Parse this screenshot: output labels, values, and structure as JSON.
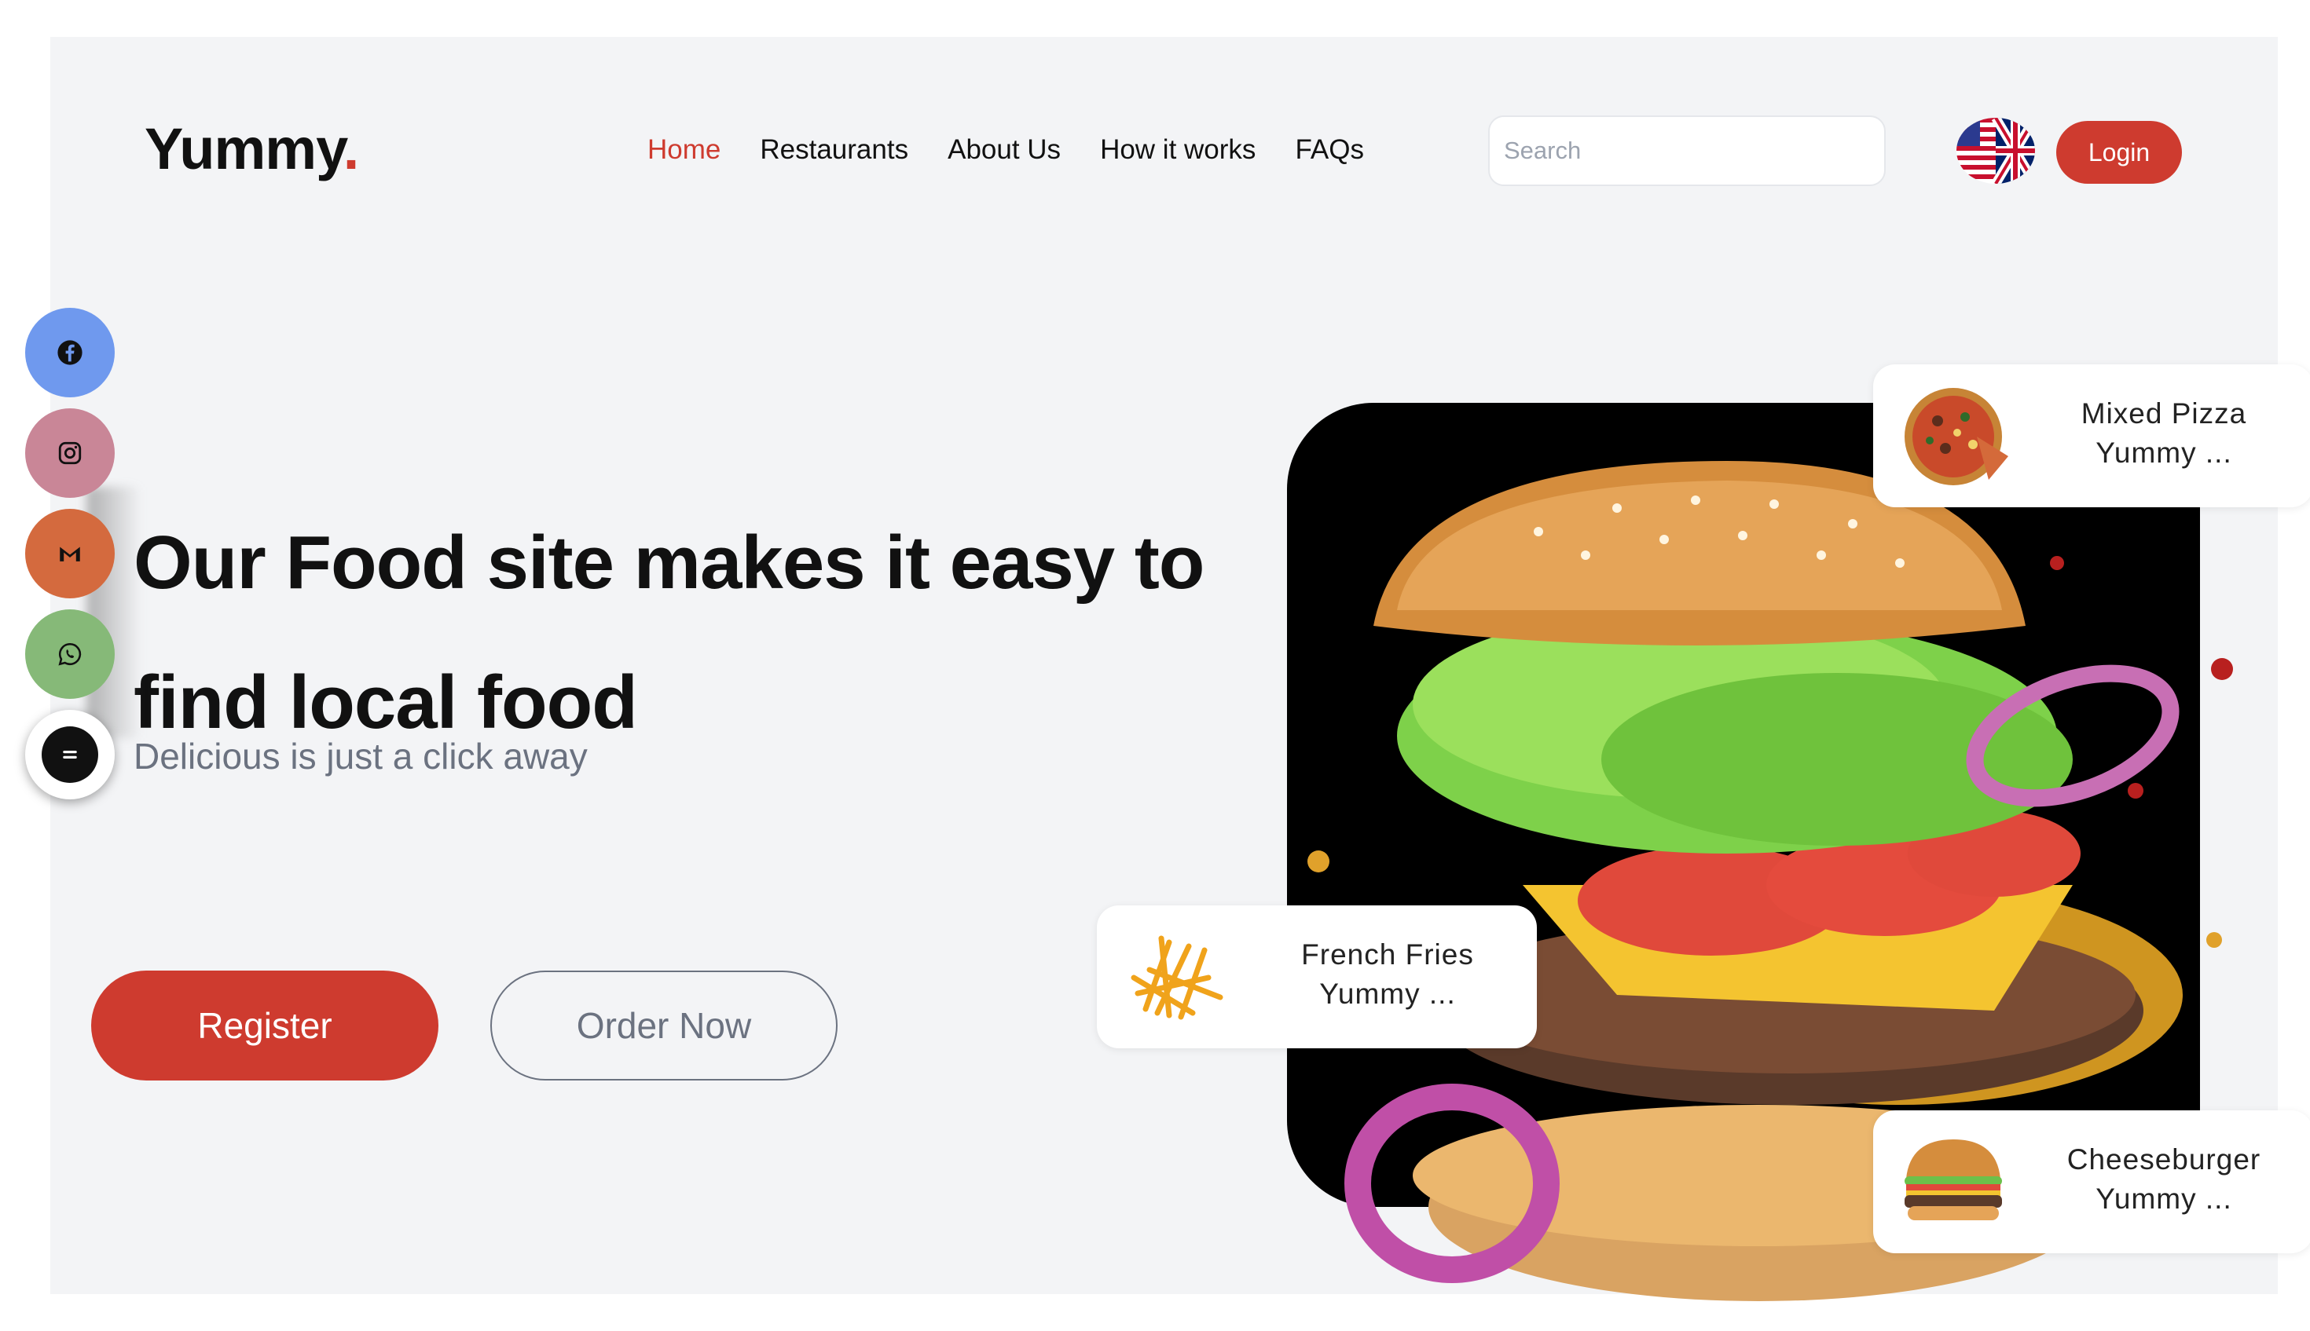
{
  "header": {
    "logo": "Yummy",
    "logo_dot": ".",
    "nav": [
      {
        "label": "Home",
        "active": true
      },
      {
        "label": "Restaurants",
        "active": false
      },
      {
        "label": "About Us",
        "active": false
      },
      {
        "label": "How it works",
        "active": false
      },
      {
        "label": "FAQs",
        "active": false
      }
    ],
    "search_placeholder": "Search",
    "language_icon": "us-uk-flag-icon",
    "login_label": "Login"
  },
  "social": [
    {
      "icon": "facebook-icon"
    },
    {
      "icon": "instagram-icon"
    },
    {
      "icon": "gmail-icon"
    },
    {
      "icon": "whatsapp-icon"
    },
    {
      "icon": "chat-icon"
    }
  ],
  "hero": {
    "title_line1": "Our Food site makes it easy to",
    "title_line2": "find local food",
    "subtitle": "Delicious is just a click away",
    "register_label": "Register",
    "order_label": "Order Now"
  },
  "cards": [
    {
      "name": "Mixed Pizza",
      "desc": "Yummy ..."
    },
    {
      "name": "French Fries",
      "desc": "Yummy ..."
    },
    {
      "name": "Cheeseburger",
      "desc": "Yummy ..."
    }
  ],
  "colors": {
    "accent": "#ce3b2f",
    "background": "#f3f4f6",
    "text": "#111111"
  }
}
